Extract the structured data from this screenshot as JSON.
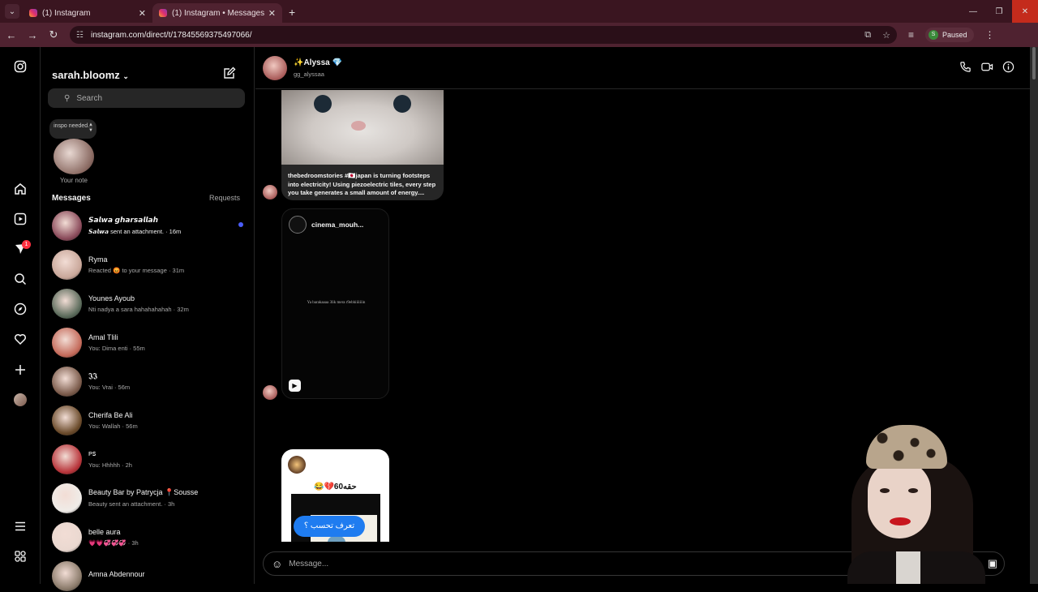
{
  "browser": {
    "tabs": [
      {
        "title": "(1) Instagram",
        "active": false
      },
      {
        "title": "(1) Instagram • Messages",
        "active": true
      }
    ],
    "url": "instagram.com/direct/t/17845569375497066/",
    "profile_initial": "S",
    "profile_status": "Paused"
  },
  "sidebar": {
    "username": "sarah.bloomz",
    "search_placeholder": "Search",
    "note_text": "inspo needed...",
    "note_label": "Your note",
    "messages_heading": "Messages",
    "requests_label": "Requests",
    "notification_count": "1"
  },
  "threads": [
    {
      "name": "𝙎𝙖𝙡𝙬𝙖 𝙜𝙝𝙖𝙧𝙨𝙖𝙡𝙡𝙖𝙝",
      "preview": "𝙎𝙖𝙡𝙬𝙖 sent an attachment. · 16m",
      "unread": true,
      "color": "#8a4a5a"
    },
    {
      "name": "Ryma",
      "preview": "Reacted 😡 to your message · 31m",
      "unread": false,
      "color": "#c9a79a"
    },
    {
      "name": "Younes Ayoub",
      "preview": "Nti nadya a sara hahahahahah · 32m",
      "unread": false,
      "color": "#5a6a5a"
    },
    {
      "name": "Amal Tlili",
      "preview": "You: Dima enti · 55m",
      "unread": false,
      "color": "#c46a5a"
    },
    {
      "name": "𝕵𝕵",
      "preview": "You: Vrai · 56m",
      "unread": false,
      "color": "#7a5a4a"
    },
    {
      "name": "Cherifa Be Ali",
      "preview": "You: Wallah · 56m",
      "unread": false,
      "color": "#6a4a2a"
    },
    {
      "name": "ᴘꜱ",
      "preview": "You: Hhhhh · 2h",
      "unread": false,
      "color": "#b8343a"
    },
    {
      "name": "Beauty Bar by Patrycja 📍Sousse",
      "preview": "Beauty sent an attachment. · 3h",
      "unread": false,
      "color": "#f0ece8"
    },
    {
      "name": "belle aura",
      "preview": "💗💗💞💞💞 · 3h",
      "unread": false,
      "color": "#ead8d0"
    },
    {
      "name": "Amna Abdennour",
      "preview": "",
      "unread": false,
      "color": "#8a7a6a"
    }
  ],
  "chat": {
    "name": "✨Alyssa 💎",
    "handle": "gg_alyssaa",
    "post_caption": "thebedroomstories #🇯🇵japan is turning footsteps into electricity! Using piezoelectric tiles, every step you take generates a small amount of energy....",
    "reel_user": "cinema_mouh...",
    "reel_text": "Ya barakaaaa 3lik mera r9ebhiiiiiiin",
    "post3_title": "😂💔60ﺣﻘﻪ",
    "post3_pill": "تعرف تحسب ؟",
    "input_placeholder": "Message..."
  }
}
